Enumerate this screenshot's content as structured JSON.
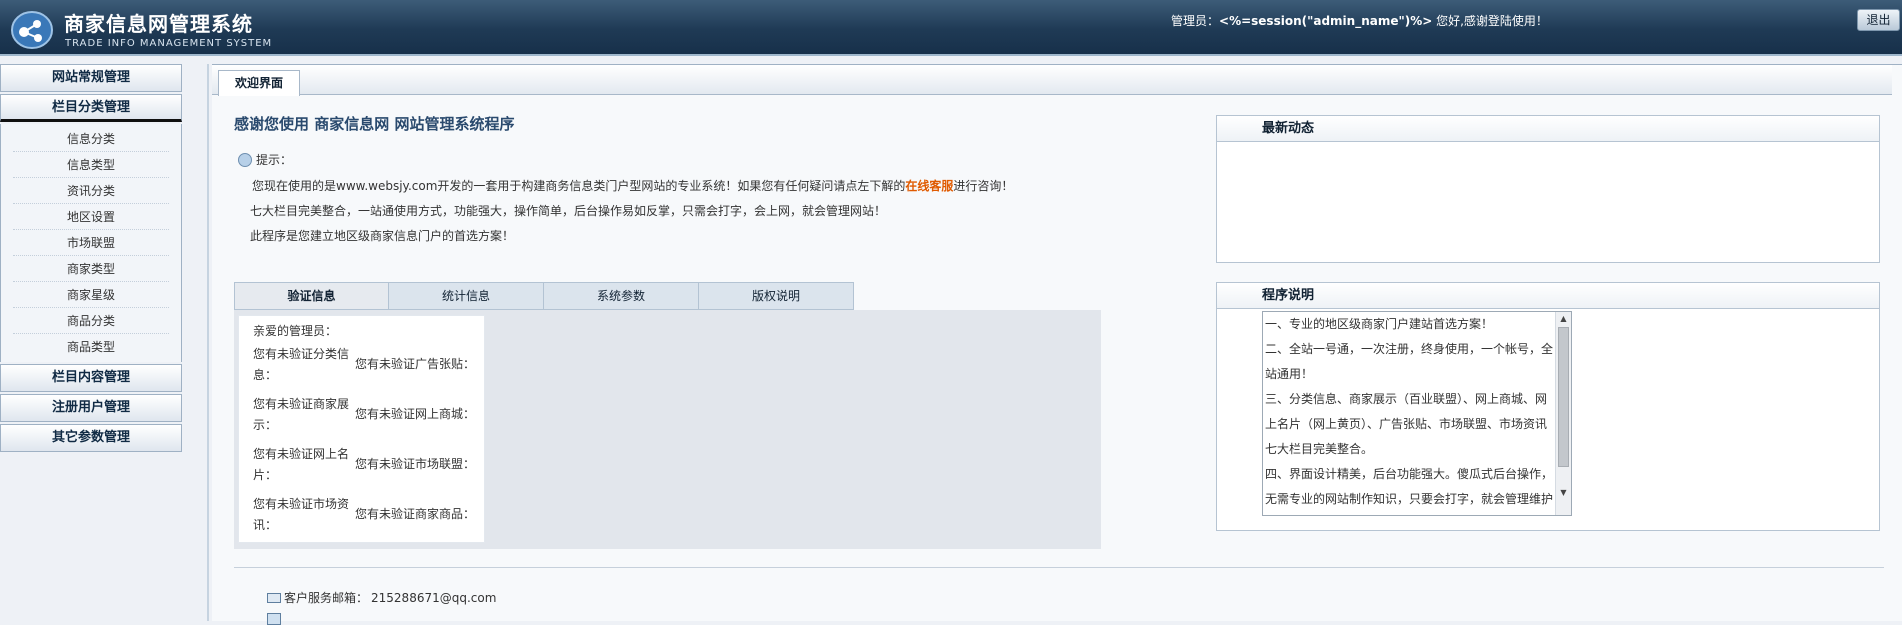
{
  "header": {
    "title": "商家信息网管理系统",
    "subtitle": "TRADE INFO MANAGEMENT SYSTEM",
    "admin_label": "管理员：",
    "admin_name": "<%=session(\"admin_name\")%>",
    "greeting": " 您好,感谢登陆使用！",
    "logout_label": "退出"
  },
  "sidebar": {
    "cat1": "网站常规管理",
    "cat2": "栏目分类管理",
    "items": [
      "信息分类",
      "信息类型",
      "资讯分类",
      "地区设置",
      "市场联盟",
      "商家类型",
      "商家星级",
      "商品分类",
      "商品类型"
    ],
    "cat3": "栏目内容管理",
    "cat4": "注册用户管理",
    "cat5": "其它参数管理"
  },
  "main": {
    "tab": "欢迎界面",
    "welcome": "感谢您使用 商家信息网 网站管理系统程序",
    "tip_label": "提示：",
    "p1_before": "您现在使用的是www.websjy.com开发的一套用于构建商务信息类门户型网站的专业系统！如果您有任何疑问请点左下解的",
    "p1_link": "在线客服",
    "p1_after": "进行咨询！",
    "p2": "七大栏目完美整合，一站通使用方式，功能强大，操作简单，后台操作易如反掌，只需会打字，会上网，就会管理网站！",
    "p3": "此程序是您建立地区级商家信息门户的首选方案！"
  },
  "info_tabs": [
    "验证信息",
    "统计信息",
    "系统参数",
    "版权说明"
  ],
  "verify": {
    "head": "亲爱的管理员：",
    "left": [
      "您有未验证分类信息：",
      "您有未验证商家展示：",
      "您有未验证网上名片：",
      "您有未验证市场资讯："
    ],
    "right": [
      "您有未验证广告张贴：",
      "您有未验证网上商城：",
      "您有未验证市场联盟：",
      "您有未验证商家商品："
    ]
  },
  "news_panel": {
    "title": "最新动态"
  },
  "desc_panel": {
    "title": "程序说明",
    "lines": [
      "一、专业的地区级商家门户建站首选方案！",
      "二、全站一号通，一次注册，终身使用，一个帐号，全",
      "站通用！",
      "三、分类信息、商家展示（百业联盟）、网上商城、网",
      "上名片（网上黄页）、广告张贴、市场联盟、市场资讯",
      "七大栏目完美整合。",
      "四、界面设计精美，后台功能强大。傻瓜式后台操作，",
      "无需专业的网站制作知识，只要会打字，就会管理维护"
    ]
  },
  "footer": {
    "email_label": "客户服务邮箱：",
    "email": "215288671@qq.com"
  }
}
